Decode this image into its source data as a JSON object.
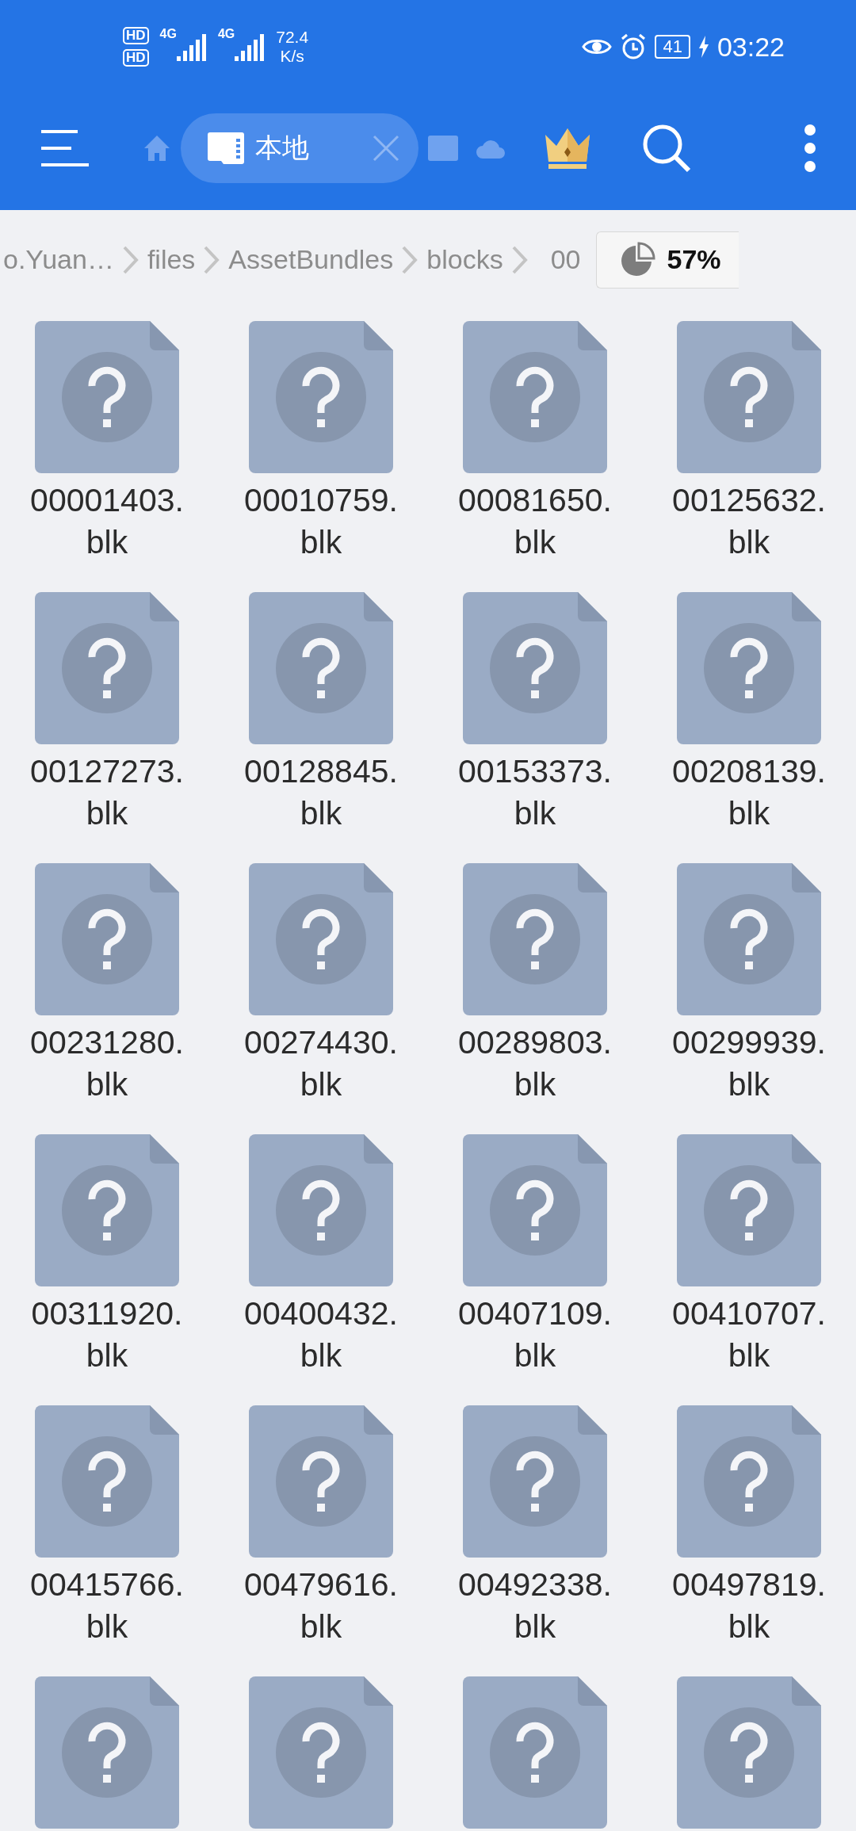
{
  "status_bar": {
    "sim_labels": [
      "HD",
      "HD"
    ],
    "network": [
      "4G",
      "4G"
    ],
    "speed": [
      "72.4",
      "K/s"
    ],
    "battery": "41",
    "time": "03:22"
  },
  "toolbar": {
    "tab": {
      "label": "本地",
      "selected": true
    }
  },
  "breadcrumb": {
    "items": [
      "o.Yuan…",
      "files",
      "AssetBundles",
      "blocks",
      "00"
    ],
    "storage": "57%"
  },
  "files": [
    {
      "kind": "file",
      "name_lines": [
        "00001403.",
        "blk"
      ]
    },
    {
      "kind": "file",
      "name_lines": [
        "00010759.",
        "blk"
      ]
    },
    {
      "kind": "file",
      "name_lines": [
        "00081650.",
        "blk"
      ]
    },
    {
      "kind": "file",
      "name_lines": [
        "00125632.",
        "blk"
      ]
    },
    {
      "kind": "file",
      "name_lines": [
        "00127273.",
        "blk"
      ]
    },
    {
      "kind": "file",
      "name_lines": [
        "00128845.",
        "blk"
      ]
    },
    {
      "kind": "file",
      "name_lines": [
        "00153373.",
        "blk"
      ]
    },
    {
      "kind": "file",
      "name_lines": [
        "00208139.",
        "blk"
      ]
    },
    {
      "kind": "file",
      "name_lines": [
        "00231280.",
        "blk"
      ]
    },
    {
      "kind": "file",
      "name_lines": [
        "00274430.",
        "blk"
      ]
    },
    {
      "kind": "file",
      "name_lines": [
        "00289803.",
        "blk"
      ]
    },
    {
      "kind": "file",
      "name_lines": [
        "00299939.",
        "blk"
      ]
    },
    {
      "kind": "file",
      "name_lines": [
        "00311920.",
        "blk"
      ]
    },
    {
      "kind": "file",
      "name_lines": [
        "00400432.",
        "blk"
      ]
    },
    {
      "kind": "file",
      "name_lines": [
        "00407109.",
        "blk"
      ]
    },
    {
      "kind": "file",
      "name_lines": [
        "00410707.",
        "blk"
      ]
    },
    {
      "kind": "file",
      "name_lines": [
        "00415766.",
        "blk"
      ]
    },
    {
      "kind": "file",
      "name_lines": [
        "00479616.",
        "blk"
      ]
    },
    {
      "kind": "file",
      "name_lines": [
        "00492338.",
        "blk"
      ]
    },
    {
      "kind": "file",
      "name_lines": [
        "00497819.",
        "blk"
      ]
    },
    {
      "kind": "file"
    },
    {
      "kind": "file"
    },
    {
      "kind": "file"
    },
    {
      "kind": "file"
    }
  ]
}
